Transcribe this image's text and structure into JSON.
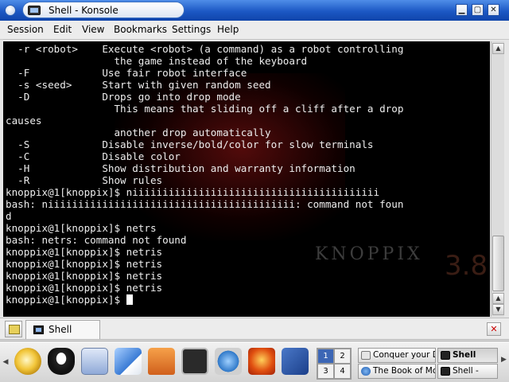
{
  "window": {
    "title": "Shell - Konsole",
    "buttons": {
      "minimize": "▁",
      "maximize": "▢",
      "close": "✕"
    }
  },
  "menubar": [
    "Session",
    "Edit",
    "View",
    "Bookmarks",
    "Settings",
    "Help"
  ],
  "terminal": {
    "lines": [
      "  -r <robot>    Execute <robot> (a command) as a robot controlling",
      "                  the game instead of the keyboard",
      "  -F            Use fair robot interface",
      "  -s <seed>     Start with given random seed",
      "  -D            Drops go into drop mode",
      "                  This means that sliding off a cliff after a drop",
      "causes",
      "                  another drop automatically",
      "  -S            Disable inverse/bold/color for slow terminals",
      "  -C            Disable color",
      "  -H            Show distribution and warranty information",
      "  -R            Show rules",
      "knoppix@1[knoppix]$ niiiiiiiiiiiiiiiiiiiiiiiiiiiiiiiiiiiiiiiii",
      "bash: niiiiiiiiiiiiiiiiiiiiiiiiiiiiiiiiiiiiiiiii: command not foun",
      "d",
      "knoppix@1[knoppix]$ netrs",
      "bash: netrs: command not found",
      "knoppix@1[knoppix]$ netris",
      "knoppix@1[knoppix]$ netris",
      "knoppix@1[knoppix]$ netris",
      "knoppix@1[knoppix]$ netris",
      "knoppix@1[knoppix]$ "
    ],
    "background_brand": "KNOPPIX",
    "background_version": "3.8"
  },
  "session_tab": {
    "label": "Shell"
  },
  "taskbar": {
    "desktops": [
      "1",
      "2",
      "3",
      "4"
    ],
    "active_desktop": "1",
    "tasks": [
      {
        "label": "Conquer your D",
        "active": false
      },
      {
        "label": "Shell",
        "active": true
      },
      {
        "label": "The Book of Mo",
        "active": false
      },
      {
        "label": "Shell -",
        "active": false
      }
    ]
  },
  "colors": {
    "titlebar": "#1c58c4",
    "terminal_bg": "#000000",
    "terminal_fg": "#ededed",
    "active_desktop": "#3c66b5"
  }
}
